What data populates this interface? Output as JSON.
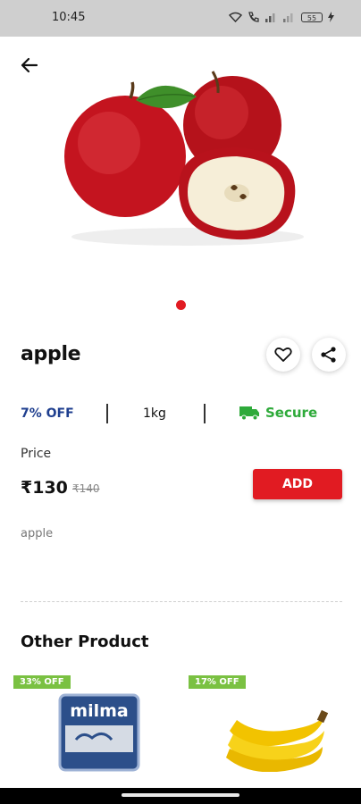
{
  "status_bar": {
    "time": "10:45",
    "battery": "55"
  },
  "product": {
    "name": "apple",
    "discount": "7% OFF",
    "weight": "1kg",
    "secure_label": "Secure",
    "price_label": "Price",
    "price": "₹130",
    "original_price": "₹140",
    "add_label": "ADD",
    "description": "apple"
  },
  "other_products": {
    "title": "Other Product",
    "items": [
      {
        "badge": "33% OFF",
        "image_icon": "milma-milk-packet-icon",
        "brand_text": "milma"
      },
      {
        "badge": "17% OFF",
        "image_icon": "banana-icon"
      }
    ]
  },
  "colors": {
    "accent": "#e11b22",
    "discount": "#1f3f8f",
    "secure": "#2eaa3a",
    "badge": "#7ac142"
  }
}
